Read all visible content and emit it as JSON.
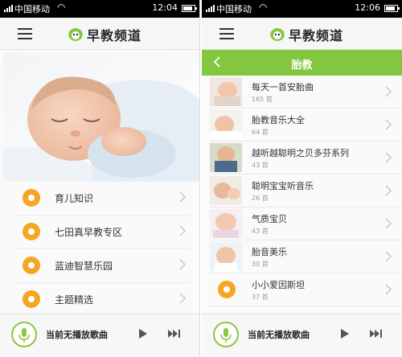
{
  "status_left": {
    "carrier": "中国移动",
    "time": "12:04"
  },
  "status_right": {
    "carrier": "中国移动",
    "time": "12:06"
  },
  "app": {
    "title": "早教频道"
  },
  "home_menu": [
    {
      "label": "育儿知识"
    },
    {
      "label": "七田真早教专区"
    },
    {
      "label": "蓝迪智慧乐园"
    },
    {
      "label": "主题精选"
    }
  ],
  "category": {
    "title": "胎教"
  },
  "songs": [
    {
      "title": "每天一首安胎曲",
      "count": "165 首",
      "icon": "baby-photo-thumbnail"
    },
    {
      "title": "胎教音乐大全",
      "count": "64 首",
      "icon": "baby-photo-thumbnail"
    },
    {
      "title": "越听越聪明之贝多芬系列",
      "count": "43 首",
      "icon": "baby-photo-thumbnail"
    },
    {
      "title": "聪明宝宝听音乐",
      "count": "26 首",
      "icon": "baby-photo-thumbnail"
    },
    {
      "title": "气质宝贝",
      "count": "43 首",
      "icon": "baby-photo-thumbnail"
    },
    {
      "title": "胎音美乐",
      "count": "30 首",
      "icon": "baby-photo-thumbnail"
    },
    {
      "title": "小小爱因斯坦",
      "count": "37 首",
      "icon": "orange-dot-icon"
    }
  ],
  "player": {
    "status_left": "当前无播放歌曲",
    "status_right": "当前无播放歌曲"
  },
  "colors": {
    "accent_green": "#83c740",
    "orange": "#f5a623",
    "status_bar": "#000000"
  }
}
